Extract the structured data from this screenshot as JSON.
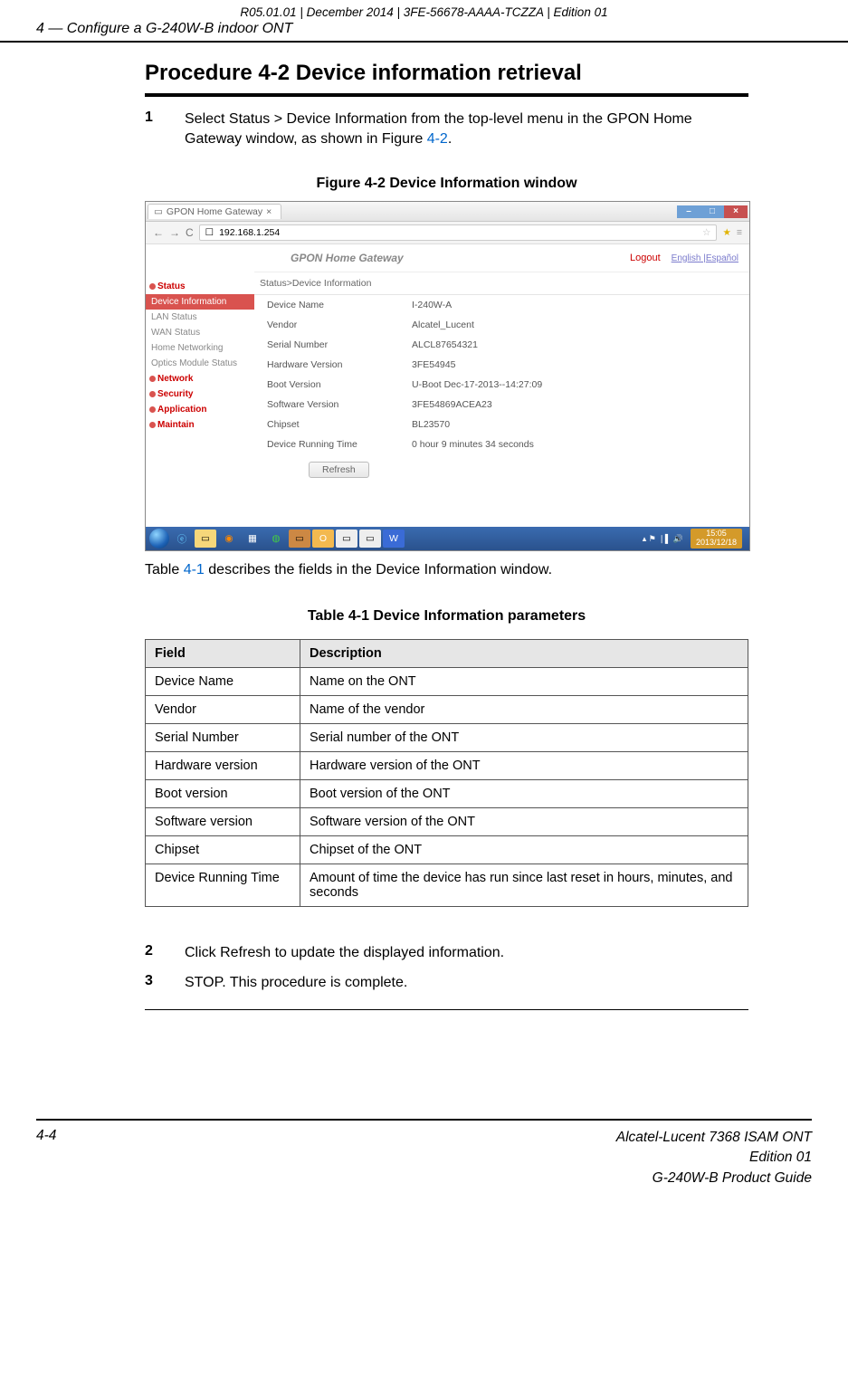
{
  "meta_top": "R05.01.01 | December 2014 | 3FE-56678-AAAA-TCZZA | Edition 01",
  "section_header": "4 —  Configure a G-240W-B indoor ONT",
  "proc_title": "Procedure 4-2  Device information retrieval",
  "step1_num": "1",
  "step1_text_a": "Select Status > Device Information from the top-level menu in the GPON Home Gateway window, as shown in Figure ",
  "step1_link": "4-2",
  "step1_text_b": ".",
  "fig_caption": "Figure 4-2  Device Information window",
  "browser": {
    "tab_label": "GPON Home Gateway",
    "tab_close": "×",
    "win_min": "–",
    "win_max": "□",
    "win_close": "×",
    "nav_back": "←",
    "nav_fwd": "→",
    "nav_reload": "C",
    "url_prefix": "☐",
    "url": "192.168.1.254",
    "brand": "GPON Home Gateway",
    "logout": "Logout",
    "lang_en": "English",
    "lang_sep": " |",
    "lang_es": "Español",
    "breadcrumb": "Status>Device Information",
    "side_status": "Status",
    "side_devinfo": "Device Information",
    "side_lan": "LAN Status",
    "side_wan": "WAN Status",
    "side_home": "Home Networking",
    "side_optics": "Optics Module Status",
    "side_net": "Network",
    "side_sec": "Security",
    "side_app": "Application",
    "side_maint": "Maintain",
    "rows": [
      {
        "k": "Device Name",
        "v": "I-240W-A"
      },
      {
        "k": "Vendor",
        "v": "Alcatel_Lucent"
      },
      {
        "k": "Serial Number",
        "v": "ALCL87654321"
      },
      {
        "k": "Hardware Version",
        "v": "3FE54945"
      },
      {
        "k": "Boot Version",
        "v": "U-Boot Dec-17-2013--14:27:09"
      },
      {
        "k": "Software Version",
        "v": "3FE54869ACEA23"
      },
      {
        "k": "Chipset",
        "v": "BL23570"
      },
      {
        "k": "Device Running Time",
        "v": "0 hour 9 minutes 34 seconds"
      }
    ],
    "refresh": "Refresh",
    "clock_time": "15:05",
    "clock_date": "2013/12/18"
  },
  "post_fig_a": "Table ",
  "post_fig_link": "4-1",
  "post_fig_b": " describes the fields in the Device Information window.",
  "table_caption": "Table 4-1 Device Information parameters",
  "th_field": "Field",
  "th_desc": "Description",
  "table_rows": [
    {
      "f": "Device Name",
      "d": "Name on the ONT"
    },
    {
      "f": "Vendor",
      "d": "Name of the vendor"
    },
    {
      "f": "Serial Number",
      "d": "Serial number of the ONT"
    },
    {
      "f": "Hardware version",
      "d": "Hardware version of the ONT"
    },
    {
      "f": "Boot version",
      "d": "Boot version of the ONT"
    },
    {
      "f": "Software version",
      "d": "Software version of the ONT"
    },
    {
      "f": "Chipset",
      "d": "Chipset of the ONT"
    },
    {
      "f": "Device Running Time",
      "d": "Amount of time the device has run since last reset in hours, minutes, and seconds"
    }
  ],
  "step2_num": "2",
  "step2_text": "Click Refresh to update the displayed information.",
  "step3_num": "3",
  "step3_text": "STOP. This procedure is complete.",
  "footer_page": "4-4",
  "footer_l1": "Alcatel-Lucent 7368 ISAM ONT",
  "footer_l2": "Edition 01",
  "footer_l3": "G-240W-B Product Guide"
}
